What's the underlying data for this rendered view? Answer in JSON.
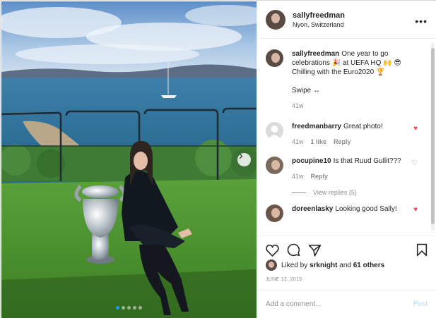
{
  "post": {
    "username": "sallyfreedman",
    "location": "Nyon, Switzerland",
    "more_label": "•••",
    "carousel_dots": 5,
    "active_dot": 0
  },
  "caption": {
    "username": "sallyfreedman",
    "text": "One year to go celebrations 🎉 at UEFA HQ 🙌 😎 Chilling with the Euro2020 🏆",
    "swipe": "Swipe ↔",
    "time": "41w"
  },
  "comments": [
    {
      "username": "freedmanbarry",
      "text": "Great photo!",
      "time": "41w",
      "likes": "1 like",
      "reply": "Reply",
      "liked": true
    },
    {
      "username": "pocupine10",
      "text": "Is that Ruud Gullit???",
      "time": "41w",
      "reply": "Reply",
      "liked": false,
      "view_replies": "View replies (5)"
    },
    {
      "username": "doreenlasky",
      "text": "Looking good Sally!",
      "liked": true
    }
  ],
  "likes": {
    "prefix": "Liked by ",
    "user": "srknight",
    "middle": " and ",
    "count": "61 others"
  },
  "date": "JUNE 13, 2019",
  "add_comment": {
    "placeholder": "Add a comment...",
    "post_label": "Post"
  },
  "colors": {
    "like_red": "#ed4956",
    "link_blue": "#b2dffc",
    "active_dot": "#1a9bf0"
  }
}
